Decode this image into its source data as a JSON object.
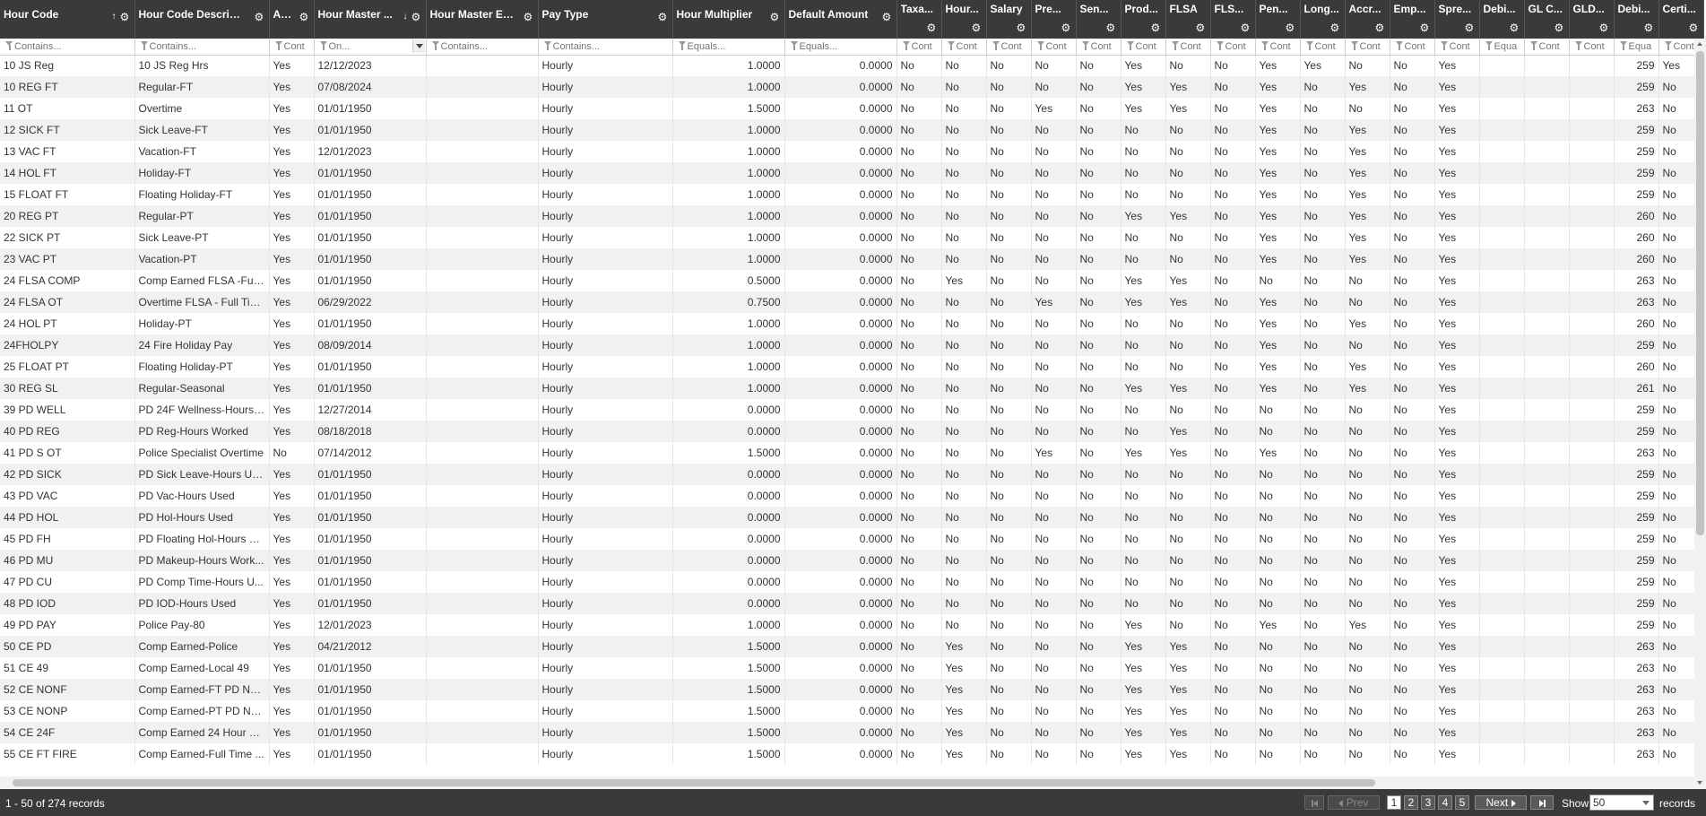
{
  "columns": [
    {
      "label": "Hour Code",
      "filter": "Contains...",
      "sort": "asc"
    },
    {
      "label": "Hour Code Description",
      "filter": "Contains..."
    },
    {
      "label": "Active",
      "filter": "Cont"
    },
    {
      "label": "Hour Master ...",
      "filter": "On...",
      "sort": "desc",
      "dropdown": true
    },
    {
      "label": "Hour Master Effe...",
      "filter": "Contains..."
    },
    {
      "label": "Pay Type",
      "filter": "Contains..."
    },
    {
      "label": "Hour Multiplier",
      "filter": "Equals..."
    },
    {
      "label": "Default Amount",
      "filter": "Equals..."
    },
    {
      "label": "Taxa...",
      "filter": "Cont"
    },
    {
      "label": "Hour...",
      "filter": "Cont"
    },
    {
      "label": "Salary",
      "filter": "Cont"
    },
    {
      "label": "Pre...",
      "filter": "Cont"
    },
    {
      "label": "Sen...",
      "filter": "Cont"
    },
    {
      "label": "Prod...",
      "filter": "Cont"
    },
    {
      "label": "FLSA",
      "filter": "Cont"
    },
    {
      "label": "FLS...",
      "filter": "Cont"
    },
    {
      "label": "Pen...",
      "filter": "Cont"
    },
    {
      "label": "Long...",
      "filter": "Cont"
    },
    {
      "label": "Accr...",
      "filter": "Cont"
    },
    {
      "label": "Emp...",
      "filter": "Cont"
    },
    {
      "label": "Spre...",
      "filter": "Cont"
    },
    {
      "label": "Debi...",
      "filter": "Equa"
    },
    {
      "label": "GL C...",
      "filter": "Cont"
    },
    {
      "label": "GLD...",
      "filter": "Cont"
    },
    {
      "label": "Debi...",
      "filter": "Equa"
    },
    {
      "label": "Certi...",
      "filter": "Cont"
    }
  ],
  "rows": [
    [
      "10 JS Reg",
      "10 JS Reg Hrs",
      "Yes",
      "12/12/2023",
      "",
      "Hourly",
      "1.0000",
      "0.0000",
      "No",
      "No",
      "No",
      "No",
      "No",
      "Yes",
      "No",
      "No",
      "Yes",
      "Yes",
      "No",
      "No",
      "Yes",
      "",
      "",
      "",
      "259",
      "Yes"
    ],
    [
      "10 REG FT",
      "Regular-FT",
      "Yes",
      "07/08/2024",
      "",
      "Hourly",
      "1.0000",
      "0.0000",
      "No",
      "No",
      "No",
      "No",
      "No",
      "Yes",
      "Yes",
      "No",
      "Yes",
      "No",
      "Yes",
      "No",
      "Yes",
      "",
      "",
      "",
      "259",
      "No"
    ],
    [
      "11 OT",
      "Overtime",
      "Yes",
      "01/01/1950",
      "",
      "Hourly",
      "1.5000",
      "0.0000",
      "No",
      "No",
      "No",
      "Yes",
      "No",
      "Yes",
      "Yes",
      "No",
      "Yes",
      "No",
      "No",
      "No",
      "Yes",
      "",
      "",
      "",
      "263",
      "No"
    ],
    [
      "12 SICK FT",
      "Sick Leave-FT",
      "Yes",
      "01/01/1950",
      "",
      "Hourly",
      "1.0000",
      "0.0000",
      "No",
      "No",
      "No",
      "No",
      "No",
      "No",
      "No",
      "No",
      "Yes",
      "No",
      "Yes",
      "No",
      "Yes",
      "",
      "",
      "",
      "259",
      "No"
    ],
    [
      "13 VAC FT",
      "Vacation-FT",
      "Yes",
      "12/01/2023",
      "",
      "Hourly",
      "1.0000",
      "0.0000",
      "No",
      "No",
      "No",
      "No",
      "No",
      "No",
      "No",
      "No",
      "Yes",
      "No",
      "Yes",
      "No",
      "Yes",
      "",
      "",
      "",
      "259",
      "No"
    ],
    [
      "14 HOL FT",
      "Holiday-FT",
      "Yes",
      "01/01/1950",
      "",
      "Hourly",
      "1.0000",
      "0.0000",
      "No",
      "No",
      "No",
      "No",
      "No",
      "No",
      "No",
      "No",
      "Yes",
      "No",
      "Yes",
      "No",
      "Yes",
      "",
      "",
      "",
      "259",
      "No"
    ],
    [
      "15 FLOAT FT",
      "Floating Holiday-FT",
      "Yes",
      "01/01/1950",
      "",
      "Hourly",
      "1.0000",
      "0.0000",
      "No",
      "No",
      "No",
      "No",
      "No",
      "No",
      "No",
      "No",
      "Yes",
      "No",
      "Yes",
      "No",
      "Yes",
      "",
      "",
      "",
      "259",
      "No"
    ],
    [
      "20 REG PT",
      "Regular-PT",
      "Yes",
      "01/01/1950",
      "",
      "Hourly",
      "1.0000",
      "0.0000",
      "No",
      "No",
      "No",
      "No",
      "No",
      "Yes",
      "Yes",
      "No",
      "Yes",
      "No",
      "Yes",
      "No",
      "Yes",
      "",
      "",
      "",
      "260",
      "No"
    ],
    [
      "22 SICK PT",
      "Sick Leave-PT",
      "Yes",
      "01/01/1950",
      "",
      "Hourly",
      "1.0000",
      "0.0000",
      "No",
      "No",
      "No",
      "No",
      "No",
      "No",
      "No",
      "No",
      "Yes",
      "No",
      "Yes",
      "No",
      "Yes",
      "",
      "",
      "",
      "260",
      "No"
    ],
    [
      "23 VAC PT",
      "Vacation-PT",
      "Yes",
      "01/01/1950",
      "",
      "Hourly",
      "1.0000",
      "0.0000",
      "No",
      "No",
      "No",
      "No",
      "No",
      "No",
      "No",
      "No",
      "Yes",
      "No",
      "Yes",
      "No",
      "Yes",
      "",
      "",
      "",
      "260",
      "No"
    ],
    [
      "24 FLSA COMP",
      "Comp Earned FLSA -Full ...",
      "Yes",
      "01/01/1950",
      "",
      "Hourly",
      "0.5000",
      "0.0000",
      "No",
      "Yes",
      "No",
      "No",
      "No",
      "Yes",
      "Yes",
      "No",
      "No",
      "No",
      "No",
      "No",
      "Yes",
      "",
      "",
      "",
      "263",
      "No"
    ],
    [
      "24 FLSA OT",
      "Overtime FLSA - Full Tim...",
      "Yes",
      "06/29/2022",
      "",
      "Hourly",
      "0.7500",
      "0.0000",
      "No",
      "No",
      "No",
      "Yes",
      "No",
      "Yes",
      "Yes",
      "No",
      "Yes",
      "No",
      "No",
      "No",
      "Yes",
      "",
      "",
      "",
      "263",
      "No"
    ],
    [
      "24 HOL PT",
      "Holiday-PT",
      "Yes",
      "01/01/1950",
      "",
      "Hourly",
      "1.0000",
      "0.0000",
      "No",
      "No",
      "No",
      "No",
      "No",
      "No",
      "No",
      "No",
      "Yes",
      "No",
      "Yes",
      "No",
      "Yes",
      "",
      "",
      "",
      "260",
      "No"
    ],
    [
      "24FHOLPY",
      "24 Fire Holiday Pay",
      "Yes",
      "08/09/2014",
      "",
      "Hourly",
      "1.0000",
      "0.0000",
      "No",
      "No",
      "No",
      "No",
      "No",
      "No",
      "No",
      "No",
      "Yes",
      "No",
      "No",
      "No",
      "Yes",
      "",
      "",
      "",
      "259",
      "No"
    ],
    [
      "25 FLOAT PT",
      "Floating Holiday-PT",
      "Yes",
      "01/01/1950",
      "",
      "Hourly",
      "1.0000",
      "0.0000",
      "No",
      "No",
      "No",
      "No",
      "No",
      "No",
      "No",
      "No",
      "Yes",
      "No",
      "Yes",
      "No",
      "Yes",
      "",
      "",
      "",
      "260",
      "No"
    ],
    [
      "30 REG SL",
      "Regular-Seasonal",
      "Yes",
      "01/01/1950",
      "",
      "Hourly",
      "1.0000",
      "0.0000",
      "No",
      "No",
      "No",
      "No",
      "No",
      "Yes",
      "Yes",
      "No",
      "Yes",
      "No",
      "Yes",
      "No",
      "Yes",
      "",
      "",
      "",
      "261",
      "No"
    ],
    [
      "39 PD WELL",
      "PD 24F Wellness-Hours ...",
      "Yes",
      "12/27/2014",
      "",
      "Hourly",
      "0.0000",
      "0.0000",
      "No",
      "No",
      "No",
      "No",
      "No",
      "No",
      "No",
      "No",
      "No",
      "No",
      "No",
      "No",
      "Yes",
      "",
      "",
      "",
      "259",
      "No"
    ],
    [
      "40 PD REG",
      "PD Reg-Hours Worked",
      "Yes",
      "08/18/2018",
      "",
      "Hourly",
      "0.0000",
      "0.0000",
      "No",
      "No",
      "No",
      "No",
      "No",
      "No",
      "Yes",
      "No",
      "No",
      "No",
      "No",
      "No",
      "Yes",
      "",
      "",
      "",
      "259",
      "No"
    ],
    [
      "41 PD S OT",
      "Police Specialist Overtime",
      "No",
      "07/14/2012",
      "",
      "Hourly",
      "1.5000",
      "0.0000",
      "No",
      "No",
      "No",
      "Yes",
      "No",
      "Yes",
      "Yes",
      "No",
      "Yes",
      "No",
      "No",
      "No",
      "Yes",
      "",
      "",
      "",
      "263",
      "No"
    ],
    [
      "42 PD SICK",
      "PD Sick Leave-Hours Used",
      "Yes",
      "01/01/1950",
      "",
      "Hourly",
      "0.0000",
      "0.0000",
      "No",
      "No",
      "No",
      "No",
      "No",
      "No",
      "No",
      "No",
      "No",
      "No",
      "No",
      "No",
      "Yes",
      "",
      "",
      "",
      "259",
      "No"
    ],
    [
      "43 PD VAC",
      "PD Vac-Hours Used",
      "Yes",
      "01/01/1950",
      "",
      "Hourly",
      "0.0000",
      "0.0000",
      "No",
      "No",
      "No",
      "No",
      "No",
      "No",
      "No",
      "No",
      "No",
      "No",
      "No",
      "No",
      "Yes",
      "",
      "",
      "",
      "259",
      "No"
    ],
    [
      "44 PD HOL",
      "PD Hol-Hours Used",
      "Yes",
      "01/01/1950",
      "",
      "Hourly",
      "0.0000",
      "0.0000",
      "No",
      "No",
      "No",
      "No",
      "No",
      "No",
      "No",
      "No",
      "No",
      "No",
      "No",
      "No",
      "Yes",
      "",
      "",
      "",
      "259",
      "No"
    ],
    [
      "45 PD FH",
      "PD Floating Hol-Hours U...",
      "Yes",
      "01/01/1950",
      "",
      "Hourly",
      "0.0000",
      "0.0000",
      "No",
      "No",
      "No",
      "No",
      "No",
      "No",
      "No",
      "No",
      "No",
      "No",
      "No",
      "No",
      "Yes",
      "",
      "",
      "",
      "259",
      "No"
    ],
    [
      "46 PD MU",
      "PD Makeup-Hours Work...",
      "Yes",
      "01/01/1950",
      "",
      "Hourly",
      "0.0000",
      "0.0000",
      "No",
      "No",
      "No",
      "No",
      "No",
      "No",
      "No",
      "No",
      "No",
      "No",
      "No",
      "No",
      "Yes",
      "",
      "",
      "",
      "259",
      "No"
    ],
    [
      "47 PD CU",
      "PD Comp Time-Hours U...",
      "Yes",
      "01/01/1950",
      "",
      "Hourly",
      "0.0000",
      "0.0000",
      "No",
      "No",
      "No",
      "No",
      "No",
      "No",
      "No",
      "No",
      "No",
      "No",
      "No",
      "No",
      "Yes",
      "",
      "",
      "",
      "259",
      "No"
    ],
    [
      "48 PD IOD",
      "PD IOD-Hours Used",
      "Yes",
      "01/01/1950",
      "",
      "Hourly",
      "0.0000",
      "0.0000",
      "No",
      "No",
      "No",
      "No",
      "No",
      "No",
      "No",
      "No",
      "No",
      "No",
      "No",
      "No",
      "Yes",
      "",
      "",
      "",
      "259",
      "No"
    ],
    [
      "49 PD PAY",
      "Police Pay-80",
      "Yes",
      "12/01/2023",
      "",
      "Hourly",
      "1.0000",
      "0.0000",
      "No",
      "No",
      "No",
      "No",
      "No",
      "Yes",
      "No",
      "No",
      "Yes",
      "No",
      "Yes",
      "No",
      "Yes",
      "",
      "",
      "",
      "259",
      "No"
    ],
    [
      "50 CE PD",
      "Comp Earned-Police",
      "Yes",
      "04/21/2012",
      "",
      "Hourly",
      "1.5000",
      "0.0000",
      "No",
      "Yes",
      "No",
      "No",
      "No",
      "Yes",
      "Yes",
      "No",
      "No",
      "No",
      "No",
      "No",
      "Yes",
      "",
      "",
      "",
      "263",
      "No"
    ],
    [
      "51 CE 49",
      "Comp Earned-Local 49",
      "Yes",
      "01/01/1950",
      "",
      "Hourly",
      "1.5000",
      "0.0000",
      "No",
      "Yes",
      "No",
      "No",
      "No",
      "Yes",
      "Yes",
      "No",
      "No",
      "No",
      "No",
      "No",
      "Yes",
      "",
      "",
      "",
      "263",
      "No"
    ],
    [
      "52 CE NONF",
      "Comp Earned-FT PD No...",
      "Yes",
      "01/01/1950",
      "",
      "Hourly",
      "1.5000",
      "0.0000",
      "No",
      "Yes",
      "No",
      "No",
      "No",
      "Yes",
      "Yes",
      "No",
      "No",
      "No",
      "No",
      "No",
      "Yes",
      "",
      "",
      "",
      "263",
      "No"
    ],
    [
      "53 CE NONP",
      "Comp Earned-PT PD No...",
      "Yes",
      "01/01/1950",
      "",
      "Hourly",
      "1.5000",
      "0.0000",
      "No",
      "Yes",
      "No",
      "No",
      "No",
      "Yes",
      "Yes",
      "No",
      "No",
      "No",
      "No",
      "No",
      "Yes",
      "",
      "",
      "",
      "263",
      "No"
    ],
    [
      "54 CE 24F",
      "Comp Earned 24 Hour Fire",
      "Yes",
      "01/01/1950",
      "",
      "Hourly",
      "1.5000",
      "0.0000",
      "No",
      "Yes",
      "No",
      "No",
      "No",
      "Yes",
      "Yes",
      "No",
      "No",
      "No",
      "No",
      "No",
      "Yes",
      "",
      "",
      "",
      "263",
      "No"
    ],
    [
      "55 CE FT FIRE",
      "Comp Earned-Full Time ...",
      "Yes",
      "01/01/1950",
      "",
      "Hourly",
      "1.5000",
      "0.0000",
      "No",
      "Yes",
      "No",
      "No",
      "No",
      "Yes",
      "Yes",
      "No",
      "No",
      "No",
      "No",
      "No",
      "Yes",
      "",
      "",
      "",
      "263",
      "No"
    ]
  ],
  "pager": {
    "info": "1 - 50 of 274 records",
    "first": "",
    "prev": "Prev",
    "pages": [
      "1",
      "2",
      "3",
      "4",
      "5"
    ],
    "current_page": "1",
    "next": "Next",
    "last": "",
    "show_label": "Show",
    "page_size": "50",
    "records_label": "records"
  },
  "colors": {
    "header_bg": "#3a3a3a",
    "stripe": "#f1f1f1"
  }
}
